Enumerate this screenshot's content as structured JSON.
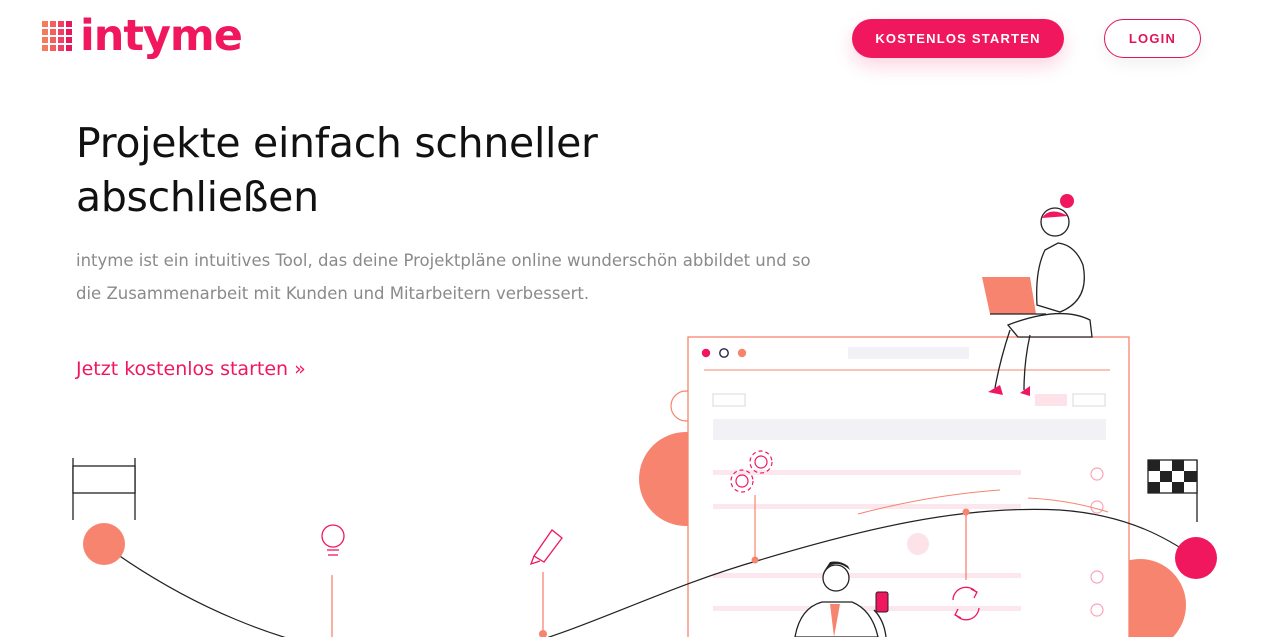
{
  "brand": {
    "name": "intyme",
    "accent_color": "#f0175f",
    "secondary_color": "#f77a5f"
  },
  "header": {
    "cta_label": "KOSTENLOS STARTEN",
    "login_label": "LOGIN"
  },
  "hero": {
    "title_line1": "Projekte einfach schneller",
    "title_line2": "abschließen",
    "subtitle_line1": "intyme ist ein intuitives Tool, das deine Projektpläne online wunderschön abbildet und so",
    "subtitle_line2": "die Zusammenarbeit mit Kunden und Mitarbeitern verbessert.",
    "cta_link": "Jetzt kostenlos starten »"
  },
  "illustration": {
    "icons": [
      "start-flag-icon",
      "lightbulb-icon",
      "pencil-icon",
      "gears-icon",
      "refresh-icon",
      "finish-flag-icon"
    ],
    "people": [
      "woman-with-laptop",
      "man-with-phone"
    ]
  }
}
